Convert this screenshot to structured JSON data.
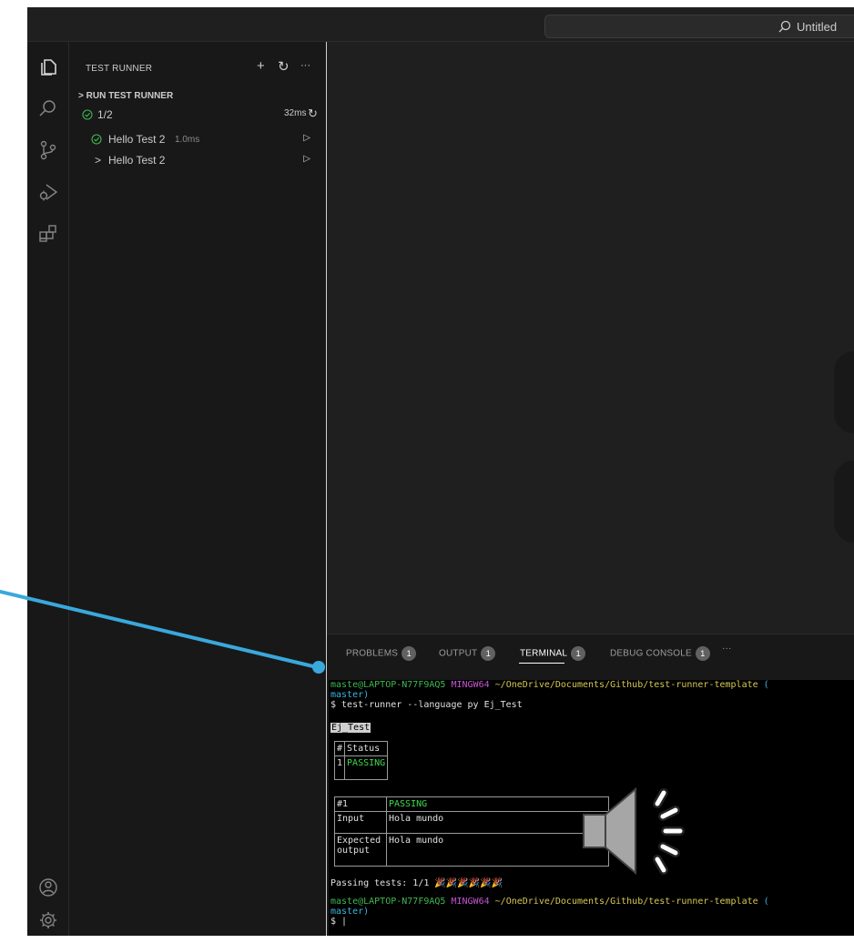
{
  "titlebar": {
    "search_text": "Untitled"
  },
  "activity_bar": {
    "icons": [
      "explorer-icon",
      "search-icon",
      "source-control-icon",
      "run-debug-icon",
      "extensions-icon",
      "account-icon",
      "settings-gear-icon"
    ]
  },
  "sidebar": {
    "title": "TEST RUNNER",
    "actions": {
      "add": "+",
      "refresh": "↻",
      "more": "···"
    },
    "section": "RUN TEST RUNNER",
    "summary": {
      "status_icon": "check-circle-icon",
      "count": "1/2",
      "duration": "32ms",
      "rerun_icon": "↻"
    },
    "items": [
      {
        "label": "Hello Test 2",
        "time": "1.0ms",
        "status_icon": "check-circle-icon",
        "action": "▷"
      },
      {
        "label": "Hello Test 2",
        "time": "",
        "status_icon": "chevron-right-icon",
        "action": "▷"
      }
    ]
  },
  "panel": {
    "tabs": [
      {
        "label": "PROBLEMS",
        "badge": "1"
      },
      {
        "label": "OUTPUT",
        "badge": "1"
      },
      {
        "label": "TERMINAL",
        "badge": "1",
        "active": true
      },
      {
        "label": "DEBUG CONSOLE",
        "badge": "1"
      }
    ],
    "more": "···"
  },
  "terminal": {
    "prompt1": {
      "user": "maste@LAPTOP-N77F9AQ5",
      "shell": "MINGW64",
      "path": "~/OneDrive/Documents/Github/test-runner-template",
      "open": "(",
      "branch": "master)"
    },
    "command": "$ test-runner --language py Ej_Test",
    "suite_name": "Ej_Test",
    "summary_table": {
      "headers": [
        "#",
        "Status"
      ],
      "rows": [
        [
          "1",
          "PASSING"
        ]
      ]
    },
    "detail_table": {
      "rows": [
        [
          "#1",
          "PASSING"
        ],
        [
          "Input",
          "Hola mundo"
        ],
        [
          "Expected output",
          "Hola mundo"
        ]
      ]
    },
    "passing_line": "Passing tests: 1/1 🎉🎉🎉🎉🎉🎉",
    "prompt2": {
      "user": "maste@LAPTOP-N77F9AQ5",
      "shell": "MINGW64",
      "path": "~/OneDrive/Documents/Github/test-runner-template",
      "open": "(",
      "branch": "master)"
    },
    "cursor_line": "$ |"
  },
  "overlay": {
    "speaker": "speaker-audio-icon",
    "pointer": "annotation-pointer-line"
  },
  "colors": {
    "accent_green": "#3fb950",
    "terminal_bg": "#000000",
    "pointer_blue": "#3aa8dc"
  }
}
